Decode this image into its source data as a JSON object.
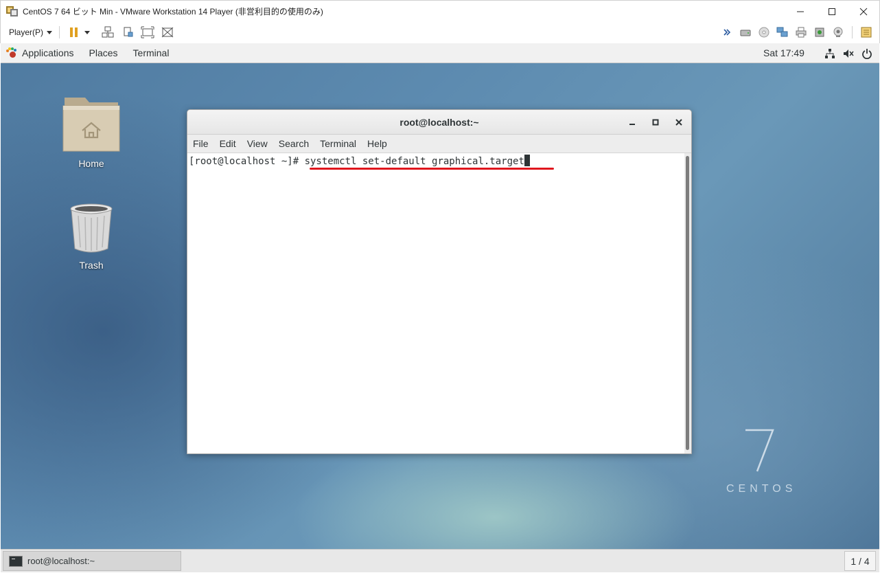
{
  "vmware": {
    "title": "CentOS 7 64 ビット Min - VMware Workstation 14 Player (非営利目的の使用のみ)",
    "player_menu": "Player(P)"
  },
  "gnome": {
    "menu": [
      "Applications",
      "Places",
      "Terminal"
    ],
    "clock": "Sat 17:49"
  },
  "desktop": {
    "home_label": "Home",
    "trash_label": "Trash",
    "os_version": "7",
    "os_name": "CENTOS"
  },
  "terminal": {
    "title": "root@localhost:~",
    "menu": [
      "File",
      "Edit",
      "View",
      "Search",
      "Terminal",
      "Help"
    ],
    "prompt": "[root@localhost ~]# ",
    "command": "systemctl set-default graphical.target",
    "annotation_color": "#e0161e"
  },
  "taskbar": {
    "task_label": "root@localhost:~",
    "workspace": "1 / 4"
  }
}
